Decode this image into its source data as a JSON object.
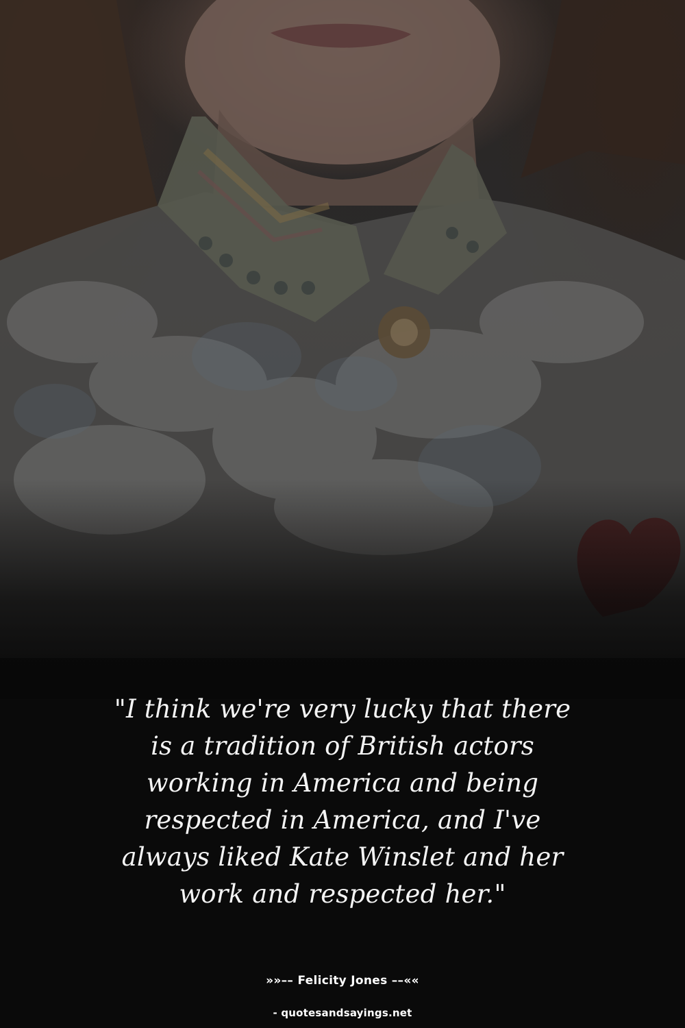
{
  "quote": {
    "lines": [
      "\"I think we're very lucky that there",
      "is a tradition of British actors",
      "working in America and being",
      "respected in America, and I've",
      "always liked Kate Winslet and her",
      "work and respected her.\""
    ]
  },
  "author": {
    "text": "»»–– Felicity Jones ––««"
  },
  "source": {
    "text": "- quotesandsayings.net"
  },
  "colors": {
    "background": "#0a0a0a",
    "text": "#ffffff"
  }
}
